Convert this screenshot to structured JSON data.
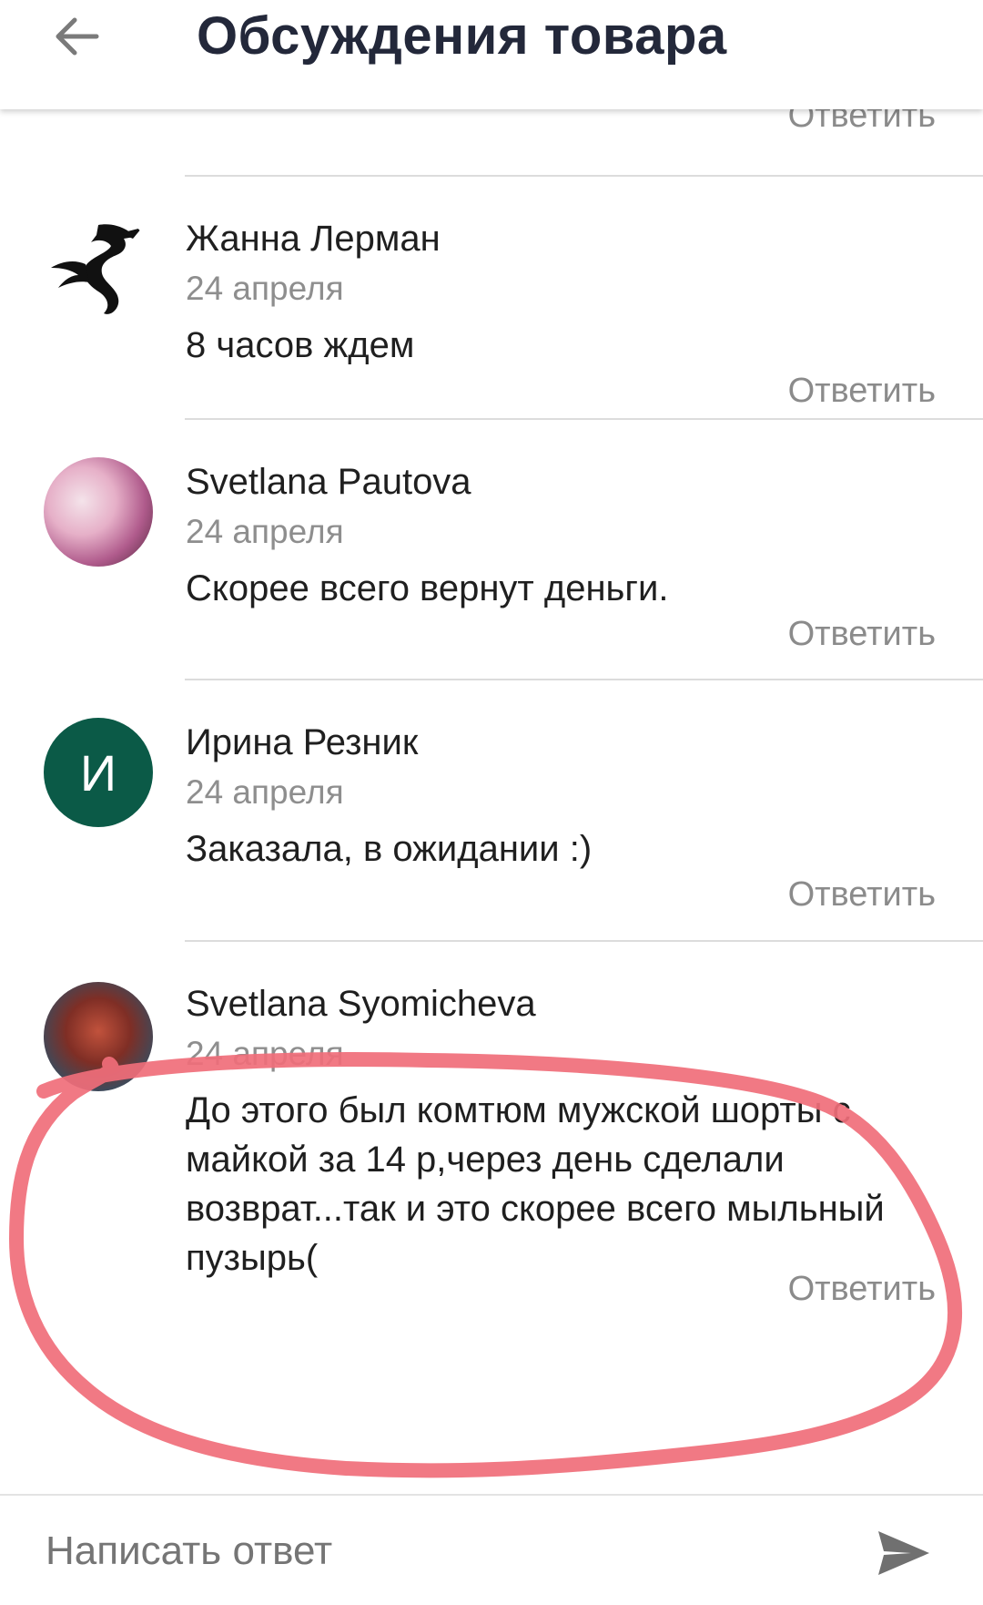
{
  "header": {
    "title": "Обсуждения товара",
    "back_icon": "arrow-left-icon"
  },
  "reply_label": "Ответить",
  "comments": [
    {
      "author": "Жанна Лерман",
      "date": "24 апреля",
      "text": "8 часов ждем",
      "reply": "Ответить",
      "avatar": "dragon-logo-icon"
    },
    {
      "author": "Svetlana Pautova",
      "date": "24 апреля",
      "text": "Скорее всего вернут деньги.",
      "reply": "Ответить",
      "avatar": "photo"
    },
    {
      "author": "Ирина Резник",
      "date": "24 апреля",
      "text": "Заказала, в ожидании :)",
      "reply": "Ответить",
      "avatar_letter": "И",
      "avatar_color": "#0b5a47"
    },
    {
      "author": "Svetlana Syomicheva",
      "date": "24 апреля",
      "text": "До этого был комтюм мужской шорты с майкой за 14 р,через день сделали возврат...так и это скорее всего мыльный пузырь(",
      "reply": "Ответить",
      "avatar": "photo"
    }
  ],
  "footer": {
    "input_placeholder": "Написать ответ",
    "send_icon": "send-icon"
  },
  "annotation": {
    "color": "#f06e79"
  }
}
